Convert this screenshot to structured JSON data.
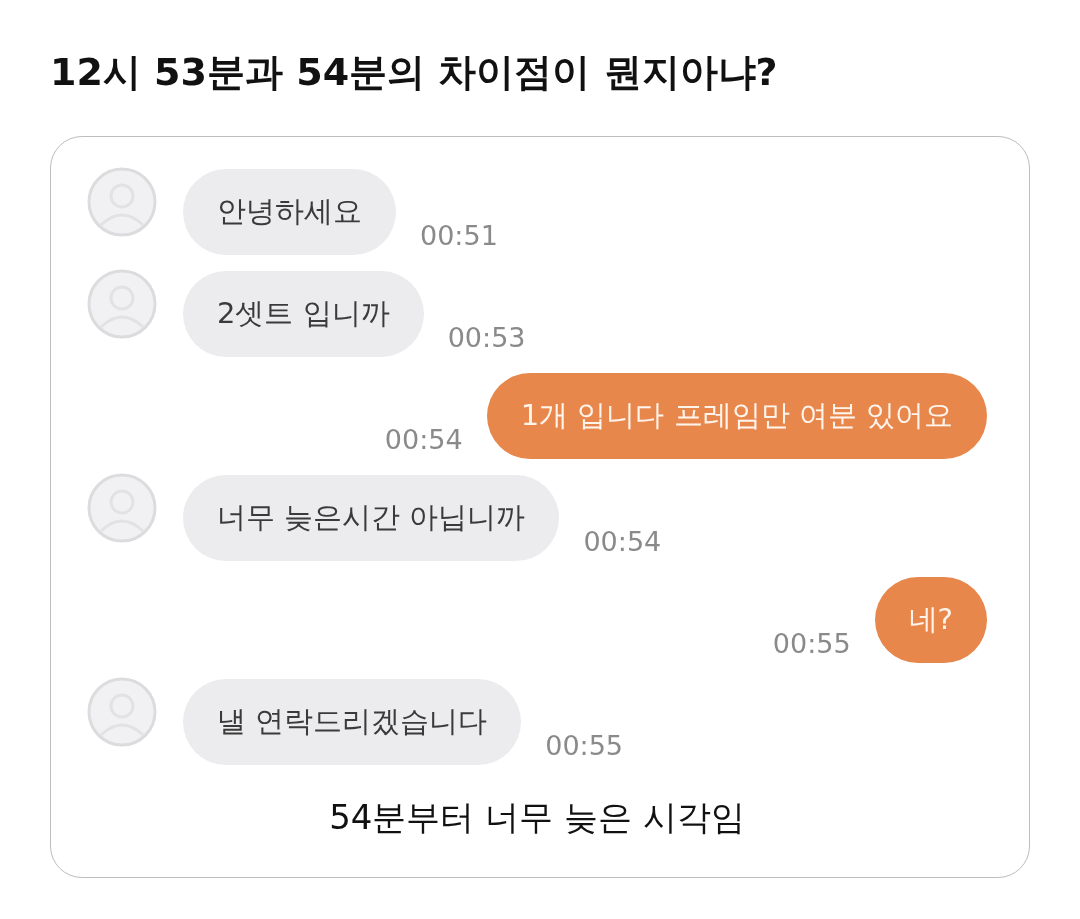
{
  "title": "12시 53분과 54분의 차이점이 뭔지아냐?",
  "chat": {
    "messages": [
      {
        "kind": "incoming",
        "text": "안녕하세요",
        "time": "00:51"
      },
      {
        "kind": "incoming",
        "text": "2셋트 입니까",
        "time": "00:53"
      },
      {
        "kind": "outgoing",
        "text": "1개 입니다 프레임만 여분 있어요",
        "time": "00:54"
      },
      {
        "kind": "incoming",
        "text": "너무 늦은시간 아닙니까",
        "time": "00:54"
      },
      {
        "kind": "outgoing",
        "text": "네?",
        "time": "00:55"
      },
      {
        "kind": "incoming",
        "text": "낼 연락드리겠습니다",
        "time": "00:55"
      }
    ]
  },
  "caption": "54분부터 너무 늦은 시각임"
}
